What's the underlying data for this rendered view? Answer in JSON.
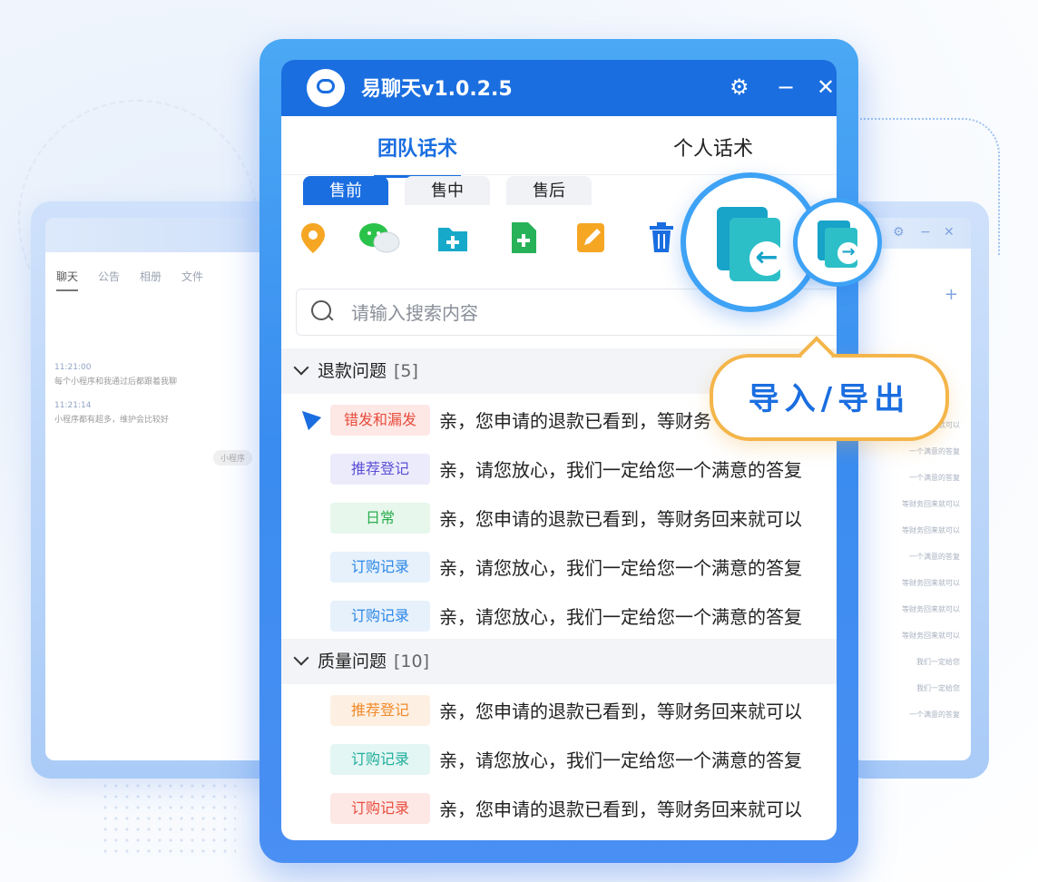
{
  "app": {
    "title": "易聊天v1.0.2.5"
  },
  "titlebar_icons": {
    "settings": "gear-icon",
    "minimize": "minimize-icon",
    "close": "close-icon"
  },
  "tabs": [
    {
      "label": "团队话术",
      "active": true
    },
    {
      "label": "个人话术",
      "active": false
    }
  ],
  "subtabs": [
    {
      "label": "售前",
      "active": true
    },
    {
      "label": "售中",
      "active": false
    },
    {
      "label": "售后",
      "active": false
    }
  ],
  "toolbar": [
    {
      "icon": "location-pin-icon",
      "color": "#f5a623"
    },
    {
      "icon": "wechat-icon",
      "color": "#2bc24a"
    },
    {
      "icon": "add-folder-icon",
      "color": "#17a9c9"
    },
    {
      "icon": "add-file-icon",
      "color": "#27b25a"
    },
    {
      "icon": "edit-icon",
      "color": "#f5a623"
    },
    {
      "icon": "trash-icon",
      "color": "#1a6ee0"
    }
  ],
  "search": {
    "placeholder": "请输入搜索内容"
  },
  "groups": [
    {
      "name": "退款问题",
      "count": "[5]",
      "items": [
        {
          "tag": "错发和漏发",
          "tag_color": "#e74c3c",
          "tag_bg": "#fde8e6",
          "text": "亲，您申请的退款已看到，等财务"
        },
        {
          "tag": "推荐登记",
          "tag_color": "#5b4fd6",
          "tag_bg": "#ecebfb",
          "text": "亲，请您放心，我们一定给您一个满意的答复"
        },
        {
          "tag": "日常",
          "tag_color": "#2bae4e",
          "tag_bg": "#e7f7ec",
          "text": "亲，您申请的退款已看到，等财务回来就可以"
        },
        {
          "tag": "订购记录",
          "tag_color": "#2a86e6",
          "tag_bg": "#e6f1fc",
          "text": "亲，请您放心，我们一定给您一个满意的答复"
        },
        {
          "tag": "订购记录",
          "tag_color": "#2a86e6",
          "tag_bg": "#e6f1fc",
          "text": "亲，请您放心，我们一定给您一个满意的答复"
        }
      ]
    },
    {
      "name": "质量问题",
      "count": "[10]",
      "items": [
        {
          "tag": "推荐登记",
          "tag_color": "#f08a2b",
          "tag_bg": "#fdf0e3",
          "text": "亲，您申请的退款已看到，等财务回来就可以"
        },
        {
          "tag": "订购记录",
          "tag_color": "#1fae9b",
          "tag_bg": "#e3f6f3",
          "text": "亲，请您放心，我们一定给您一个满意的答复"
        },
        {
          "tag": "订购记录",
          "tag_color": "#e74c3c",
          "tag_bg": "#fde8e6",
          "text": "亲，您申请的退款已看到，等财务回来就可以"
        }
      ]
    }
  ],
  "overlay": {
    "import_export_label": "导入/导出"
  },
  "left_window": {
    "tabs": [
      "聊天",
      "公告",
      "相册",
      "文件"
    ],
    "messages": [
      {
        "time": "11:21:00",
        "text": "每个小程序和我通过后都跟着我聊"
      },
      {
        "time": "11:21:14",
        "text": "小程序都有超多，维护会比较好"
      }
    ],
    "pill": "小程序"
  },
  "right_window": {
    "lines": [
      "等财务回来就可以",
      "一个满意的答复",
      "一个满意的答复",
      "等财务回来就可以",
      "等财务回来就可以",
      "一个满意的答复",
      "等财务回来就可以",
      "等财务回来就可以",
      "等财务回来就可以",
      "我们一定给您",
      "我们一定给您",
      "一个满意的答复"
    ]
  }
}
